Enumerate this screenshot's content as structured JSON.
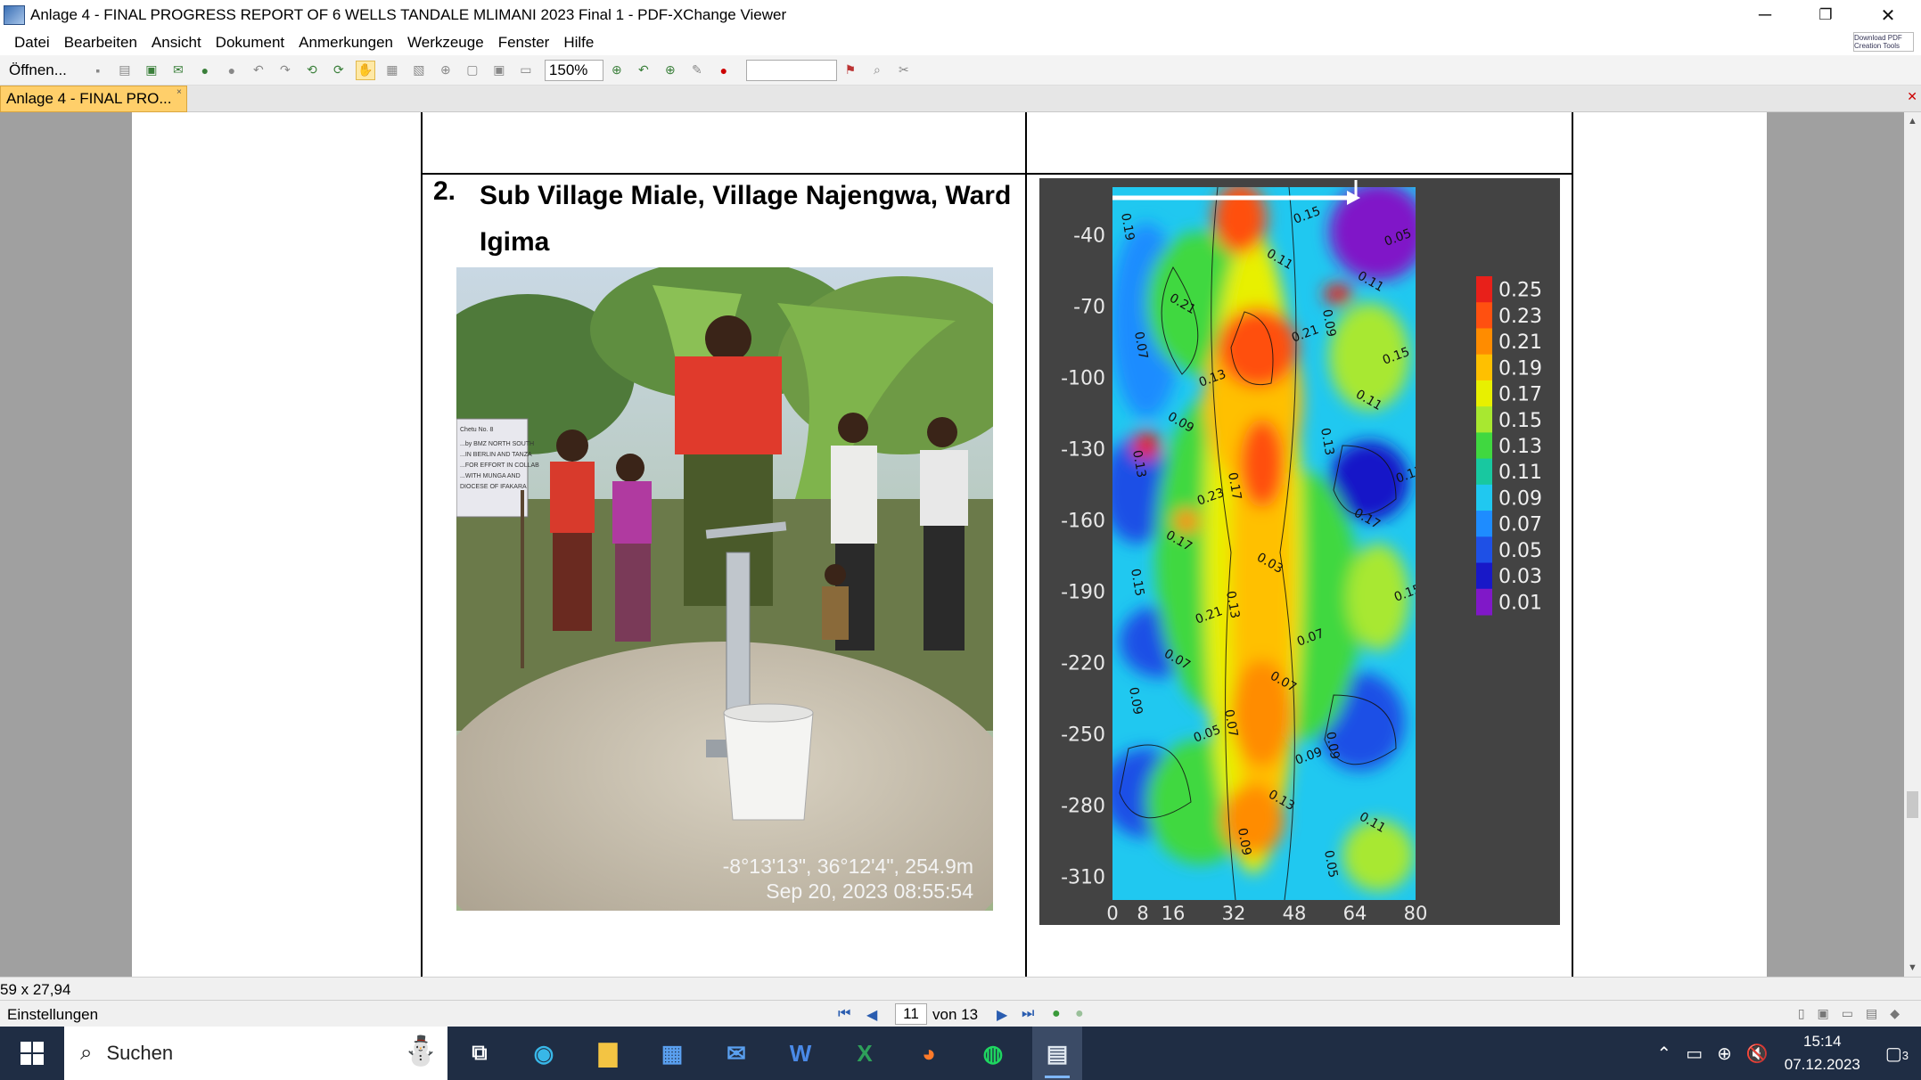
{
  "window": {
    "title": "Anlage 4 - FINAL PROGRESS REPORT OF 6 WELLS TANDALE MLIMANI 2023 Final 1 - PDF-XChange Viewer",
    "minimize": "─",
    "maximize": "❐",
    "close": "✕"
  },
  "menu": [
    "Datei",
    "Bearbeiten",
    "Ansicht",
    "Dokument",
    "Anmerkungen",
    "Werkzeuge",
    "Fenster",
    "Hilfe"
  ],
  "download_badge": "Download PDF Creation Tools",
  "toolbar": {
    "open_label": "Öffnen...",
    "zoom_value": "150%",
    "search_value": ""
  },
  "tab": {
    "label": "Anlage 4 - FINAL PRO...",
    "close": "×"
  },
  "document": {
    "section_number": "2.",
    "section_heading": "Sub Village Miale, Village Najengwa, Ward Igima",
    "photo_caption_coords": "-8°13'13\", 36°12'4\", 254.9m",
    "photo_caption_datetime": "Sep 20, 2023 08:55:54",
    "photo_sign_lines": [
      "Chetu No. 8",
      "...by BMZ NORTH SOUTH",
      "...IN BERLIN AND TANZA",
      "...FOR EFFORT IN COLLAB",
      "...WITH MUNGA AND",
      "DIOCESE OF IFAKARA"
    ]
  },
  "chart_data": {
    "type": "heatmap",
    "title": "",
    "xlabel": "",
    "ylabel": "",
    "x_ticks": [
      "0",
      "8",
      "16",
      "32",
      "48",
      "64",
      "80"
    ],
    "x_range": [
      0,
      80
    ],
    "y_ticks": [
      "-40",
      "-70",
      "-100",
      "-130",
      "-160",
      "-190",
      "-220",
      "-250",
      "-280",
      "-310"
    ],
    "y_range": [
      -320,
      -20
    ],
    "colorbar": {
      "labels": [
        "0.25",
        "0.23",
        "0.21",
        "0.19",
        "0.17",
        "0.15",
        "0.13",
        "0.11",
        "0.09",
        "0.07",
        "0.05",
        "0.03",
        "0.01"
      ],
      "colors": [
        "#e8201a",
        "#ff5010",
        "#ff8c00",
        "#ffc000",
        "#e8f000",
        "#a8e830",
        "#40d840",
        "#18c8a0",
        "#20c8f0",
        "#1e8cff",
        "#1e50e6",
        "#1818c8",
        "#8018c8"
      ]
    },
    "contour_labels": [
      "0.19",
      "0.21",
      "0.13",
      "0.17",
      "0.03",
      "0.07",
      "0.09",
      "0.11",
      "0.05",
      "0.07",
      "0.09",
      "0.23",
      "0.13",
      "0.07",
      "0.09",
      "0.05",
      "0.11",
      "0.15",
      "0.13",
      "0.17",
      "0.21",
      "0.07",
      "0.13",
      "0.15",
      "0.09",
      "0.11",
      "0.13",
      "0.15",
      "0.07",
      "0.05",
      "0.09",
      "0.11",
      "0.21",
      "0.13",
      "0.17",
      "0.15",
      "0.09"
    ]
  },
  "status": {
    "page_size": "59 x 27,94",
    "settings": "Einstellungen",
    "current_page": "11",
    "page_of": "von 13"
  },
  "taskbar": {
    "search_label": "Suchen",
    "apps": [
      "task-view",
      "edge",
      "explorer",
      "store",
      "mail",
      "word",
      "excel",
      "firefox",
      "spotify",
      "pdf-xchange"
    ],
    "time": "15:14",
    "date": "07.12.2023",
    "notifications": "3"
  }
}
